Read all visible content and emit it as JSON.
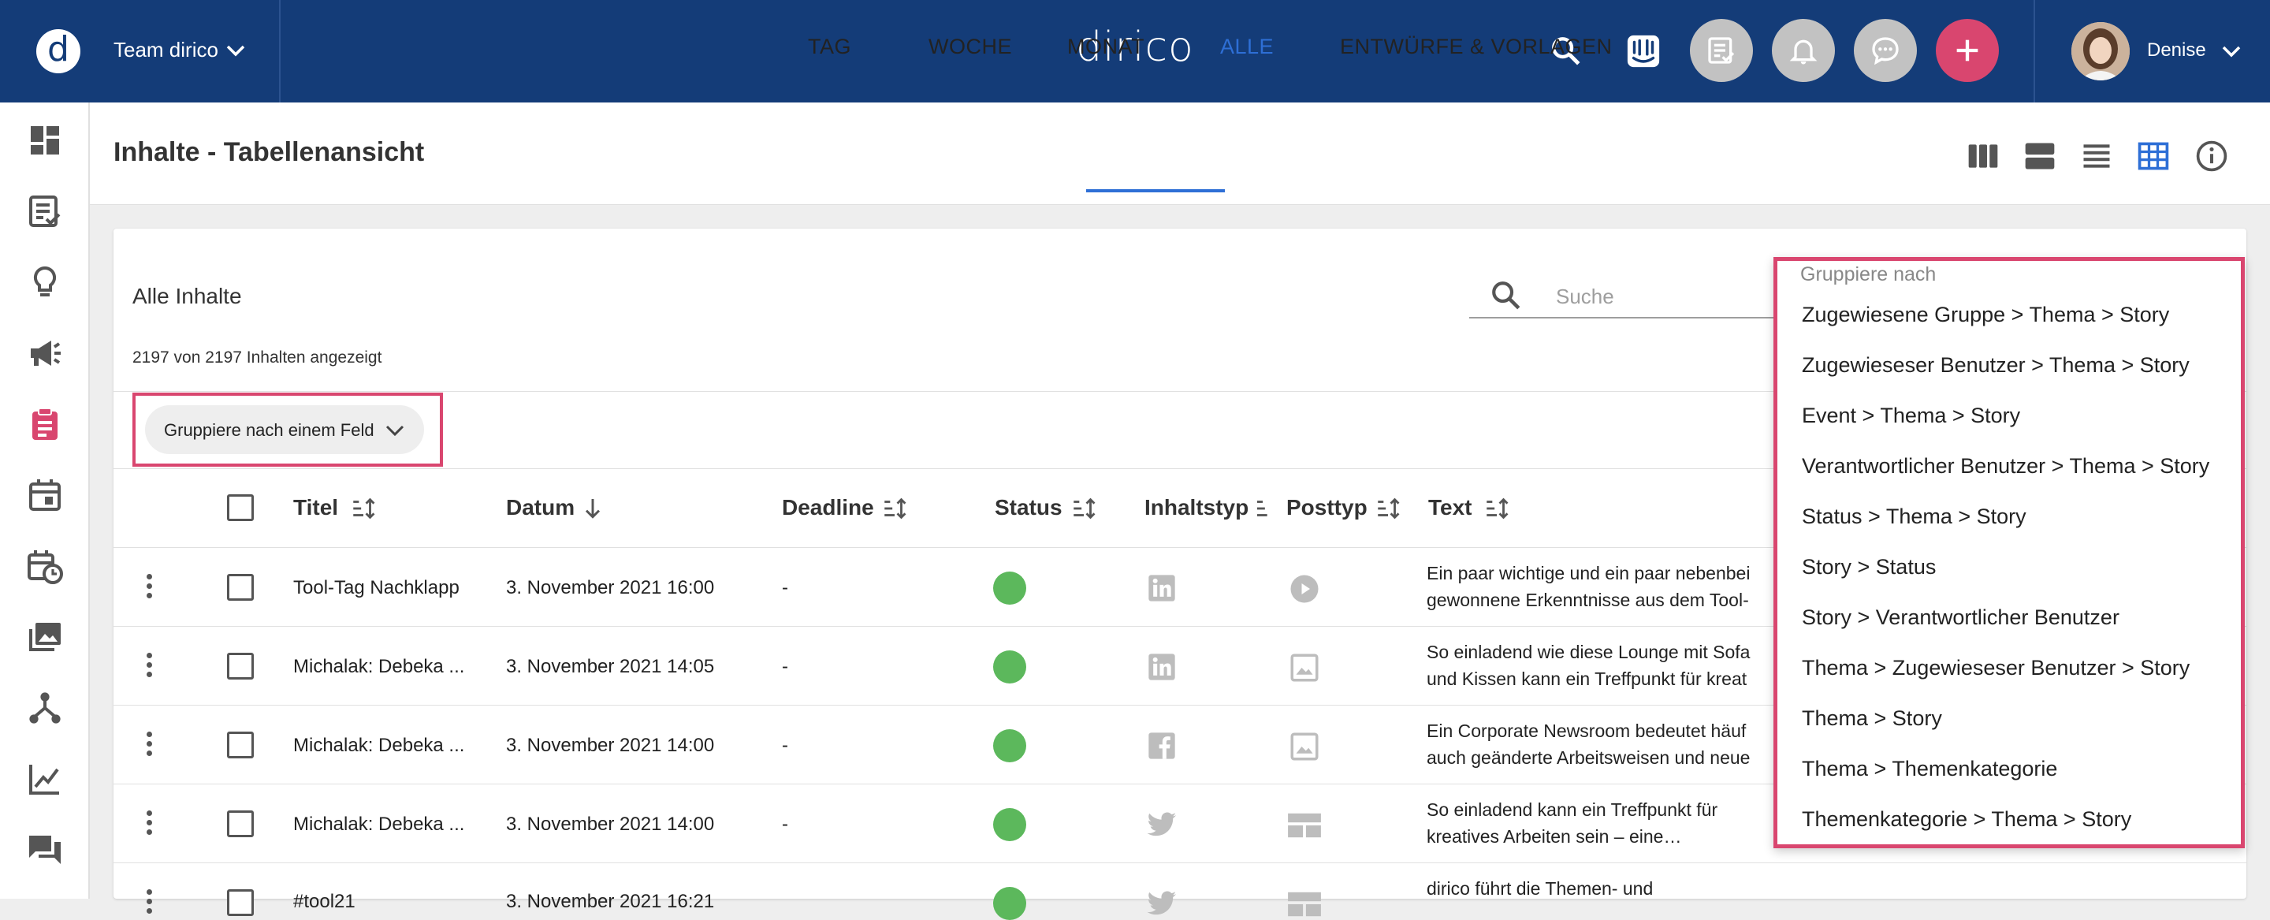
{
  "topbar": {
    "team_initial": "d",
    "team_name": "Team dirico",
    "brand": "dirico",
    "user_name": "Denise",
    "colors": {
      "bar": "#143c78",
      "add_button": "#d9466f",
      "circle_button": "#c2c2c2"
    }
  },
  "sidebar": {
    "icons": [
      "dashboard-icon",
      "content-list-icon",
      "idea-icon",
      "campaign-icon",
      "clipboard-icon",
      "calendar-icon",
      "schedule-icon",
      "media-icon",
      "network-icon",
      "analytics-icon",
      "chat-icon"
    ],
    "active_index": 4
  },
  "subheader": {
    "title": "Inhalte - Tabellenansicht",
    "tabs": [
      {
        "label": "TAG"
      },
      {
        "label": "WOCHE"
      },
      {
        "label": "MONAT"
      },
      {
        "label": "ALLE"
      },
      {
        "label": "ENTWÜRFE & VORLAGEN"
      }
    ],
    "active_tab": "ALLE"
  },
  "card": {
    "title": "Alle Inhalte",
    "search_placeholder": "Suche",
    "count_text": "2197 von 2197 Inhalten angezeigt",
    "group_chip_label": "Gruppiere nach einem Feld"
  },
  "table": {
    "headers": {
      "title": "Titel",
      "date": "Datum",
      "deadline": "Deadline",
      "status": "Status",
      "content_type": "Inhaltstyp",
      "post_type": "Posttyp",
      "text": "Text"
    },
    "rows": [
      {
        "title": "Tool-Tag Nachklapp",
        "date": "3. November 2021 16:00",
        "deadline": "-",
        "channel": "linkedin-icon",
        "post": "video-icon",
        "text1": "Ein paar wichtige und ein paar nebenbei",
        "text2": "gewonnene Erkenntnisse aus dem Tool-"
      },
      {
        "title": "Michalak: Debeka ...",
        "date": "3. November 2021 14:05",
        "deadline": "-",
        "channel": "linkedin-icon",
        "post": "image-icon",
        "text1": "So einladend wie diese Lounge mit Sofa",
        "text2": "und Kissen kann ein Treffpunkt für kreat"
      },
      {
        "title": "Michalak: Debeka ...",
        "date": "3. November 2021 14:00",
        "deadline": "-",
        "channel": "facebook-icon",
        "post": "image-icon",
        "text1": "Ein Corporate Newsroom bedeutet häuf",
        "text2": "auch geänderte Arbeitsweisen und neue"
      },
      {
        "title": "Michalak: Debeka ...",
        "date": "3. November 2021 14:00",
        "deadline": "-",
        "channel": "twitter-icon",
        "post": "layout-icon",
        "text1": "So einladend kann ein Treffpunkt für",
        "text2": "kreatives Arbeiten sein – eine…"
      },
      {
        "title": "#tool21",
        "date": "3. November 2021 16:21",
        "deadline": "",
        "channel": "twitter-icon",
        "post": "layout-icon",
        "text1": "dirico führt die Themen- und",
        "text2": ""
      }
    ]
  },
  "dropdown": {
    "header": "Gruppiere nach",
    "items": [
      "Zugewiesene Gruppe > Thema > Story",
      "Zugewieseser Benutzer > Thema > Story",
      "Event > Thema > Story",
      "Verantwortlicher Benutzer > Thema > Story",
      "Status > Thema > Story",
      "Story > Status",
      "Story > Verantwortlicher Benutzer",
      "Thema > Zugewieseser Benutzer > Story",
      "Thema > Story",
      "Thema > Themenkategorie",
      "Themenkategorie > Thema > Story"
    ]
  }
}
